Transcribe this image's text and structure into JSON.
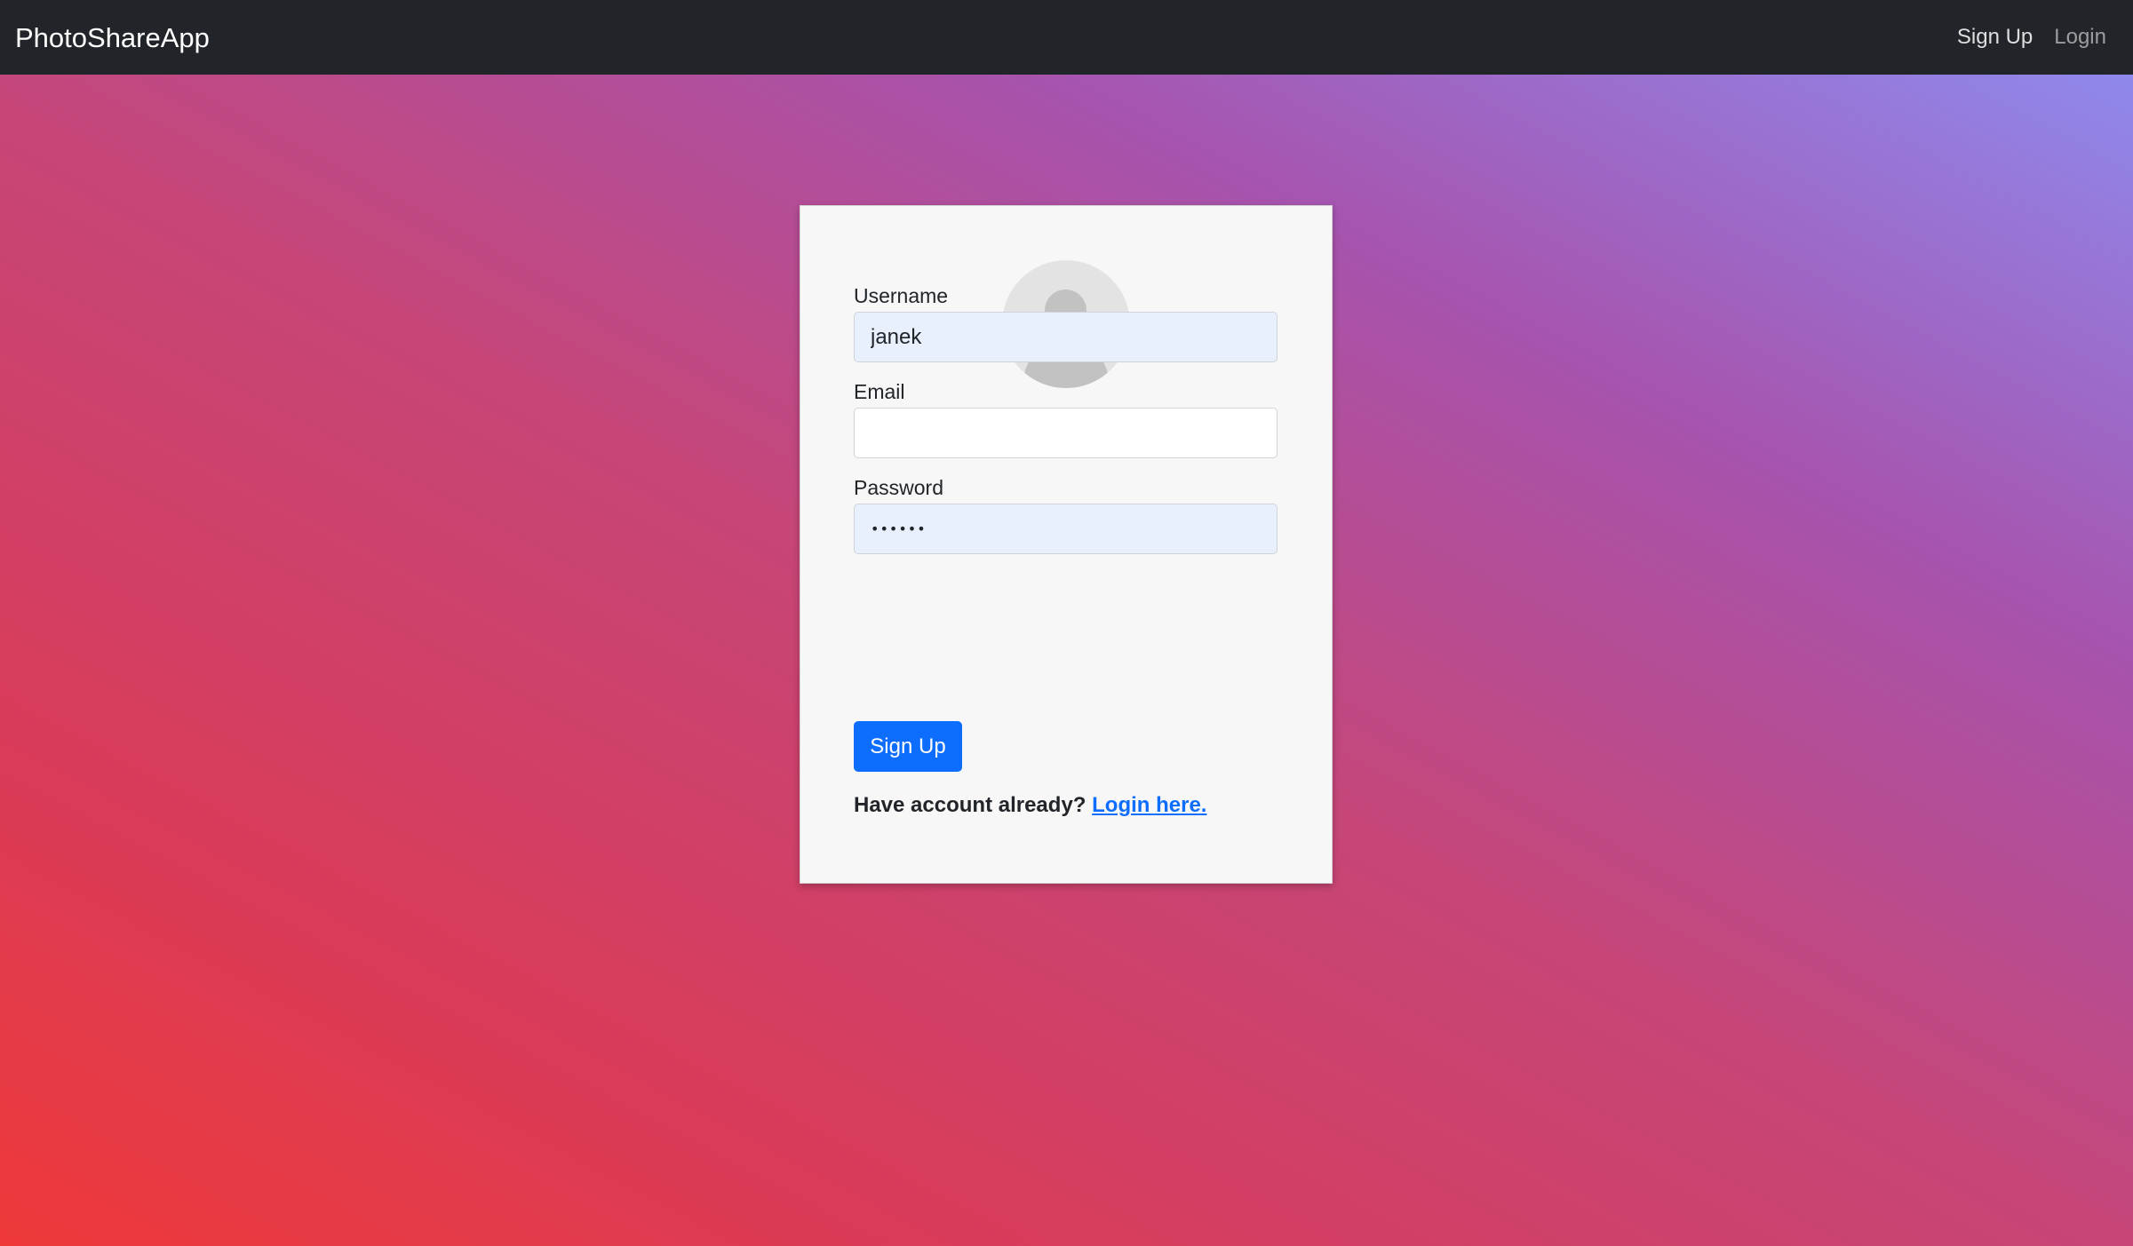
{
  "navbar": {
    "brand": "PhotoShareApp",
    "links": [
      {
        "label": "Sign Up",
        "active": true
      },
      {
        "label": "Login",
        "active": false
      }
    ]
  },
  "form": {
    "avatar_icon": "user-placeholder-icon",
    "fields": {
      "username": {
        "label": "Username",
        "value": "janek",
        "placeholder": ""
      },
      "email": {
        "label": "Email",
        "value": "",
        "placeholder": ""
      },
      "password": {
        "label": "Password",
        "value": "••••••",
        "placeholder": ""
      }
    },
    "submit_label": "Sign Up",
    "footer_text": "Have account already?",
    "footer_link": "Login here."
  },
  "colors": {
    "navbar_bg": "#212529",
    "primary": "#0d6efd",
    "autofill_bg": "#e8f0fe",
    "card_bg": "#f7f7f7",
    "background_gradient_start": "#ee3838",
    "background_gradient_end": "#8c8ff4"
  }
}
